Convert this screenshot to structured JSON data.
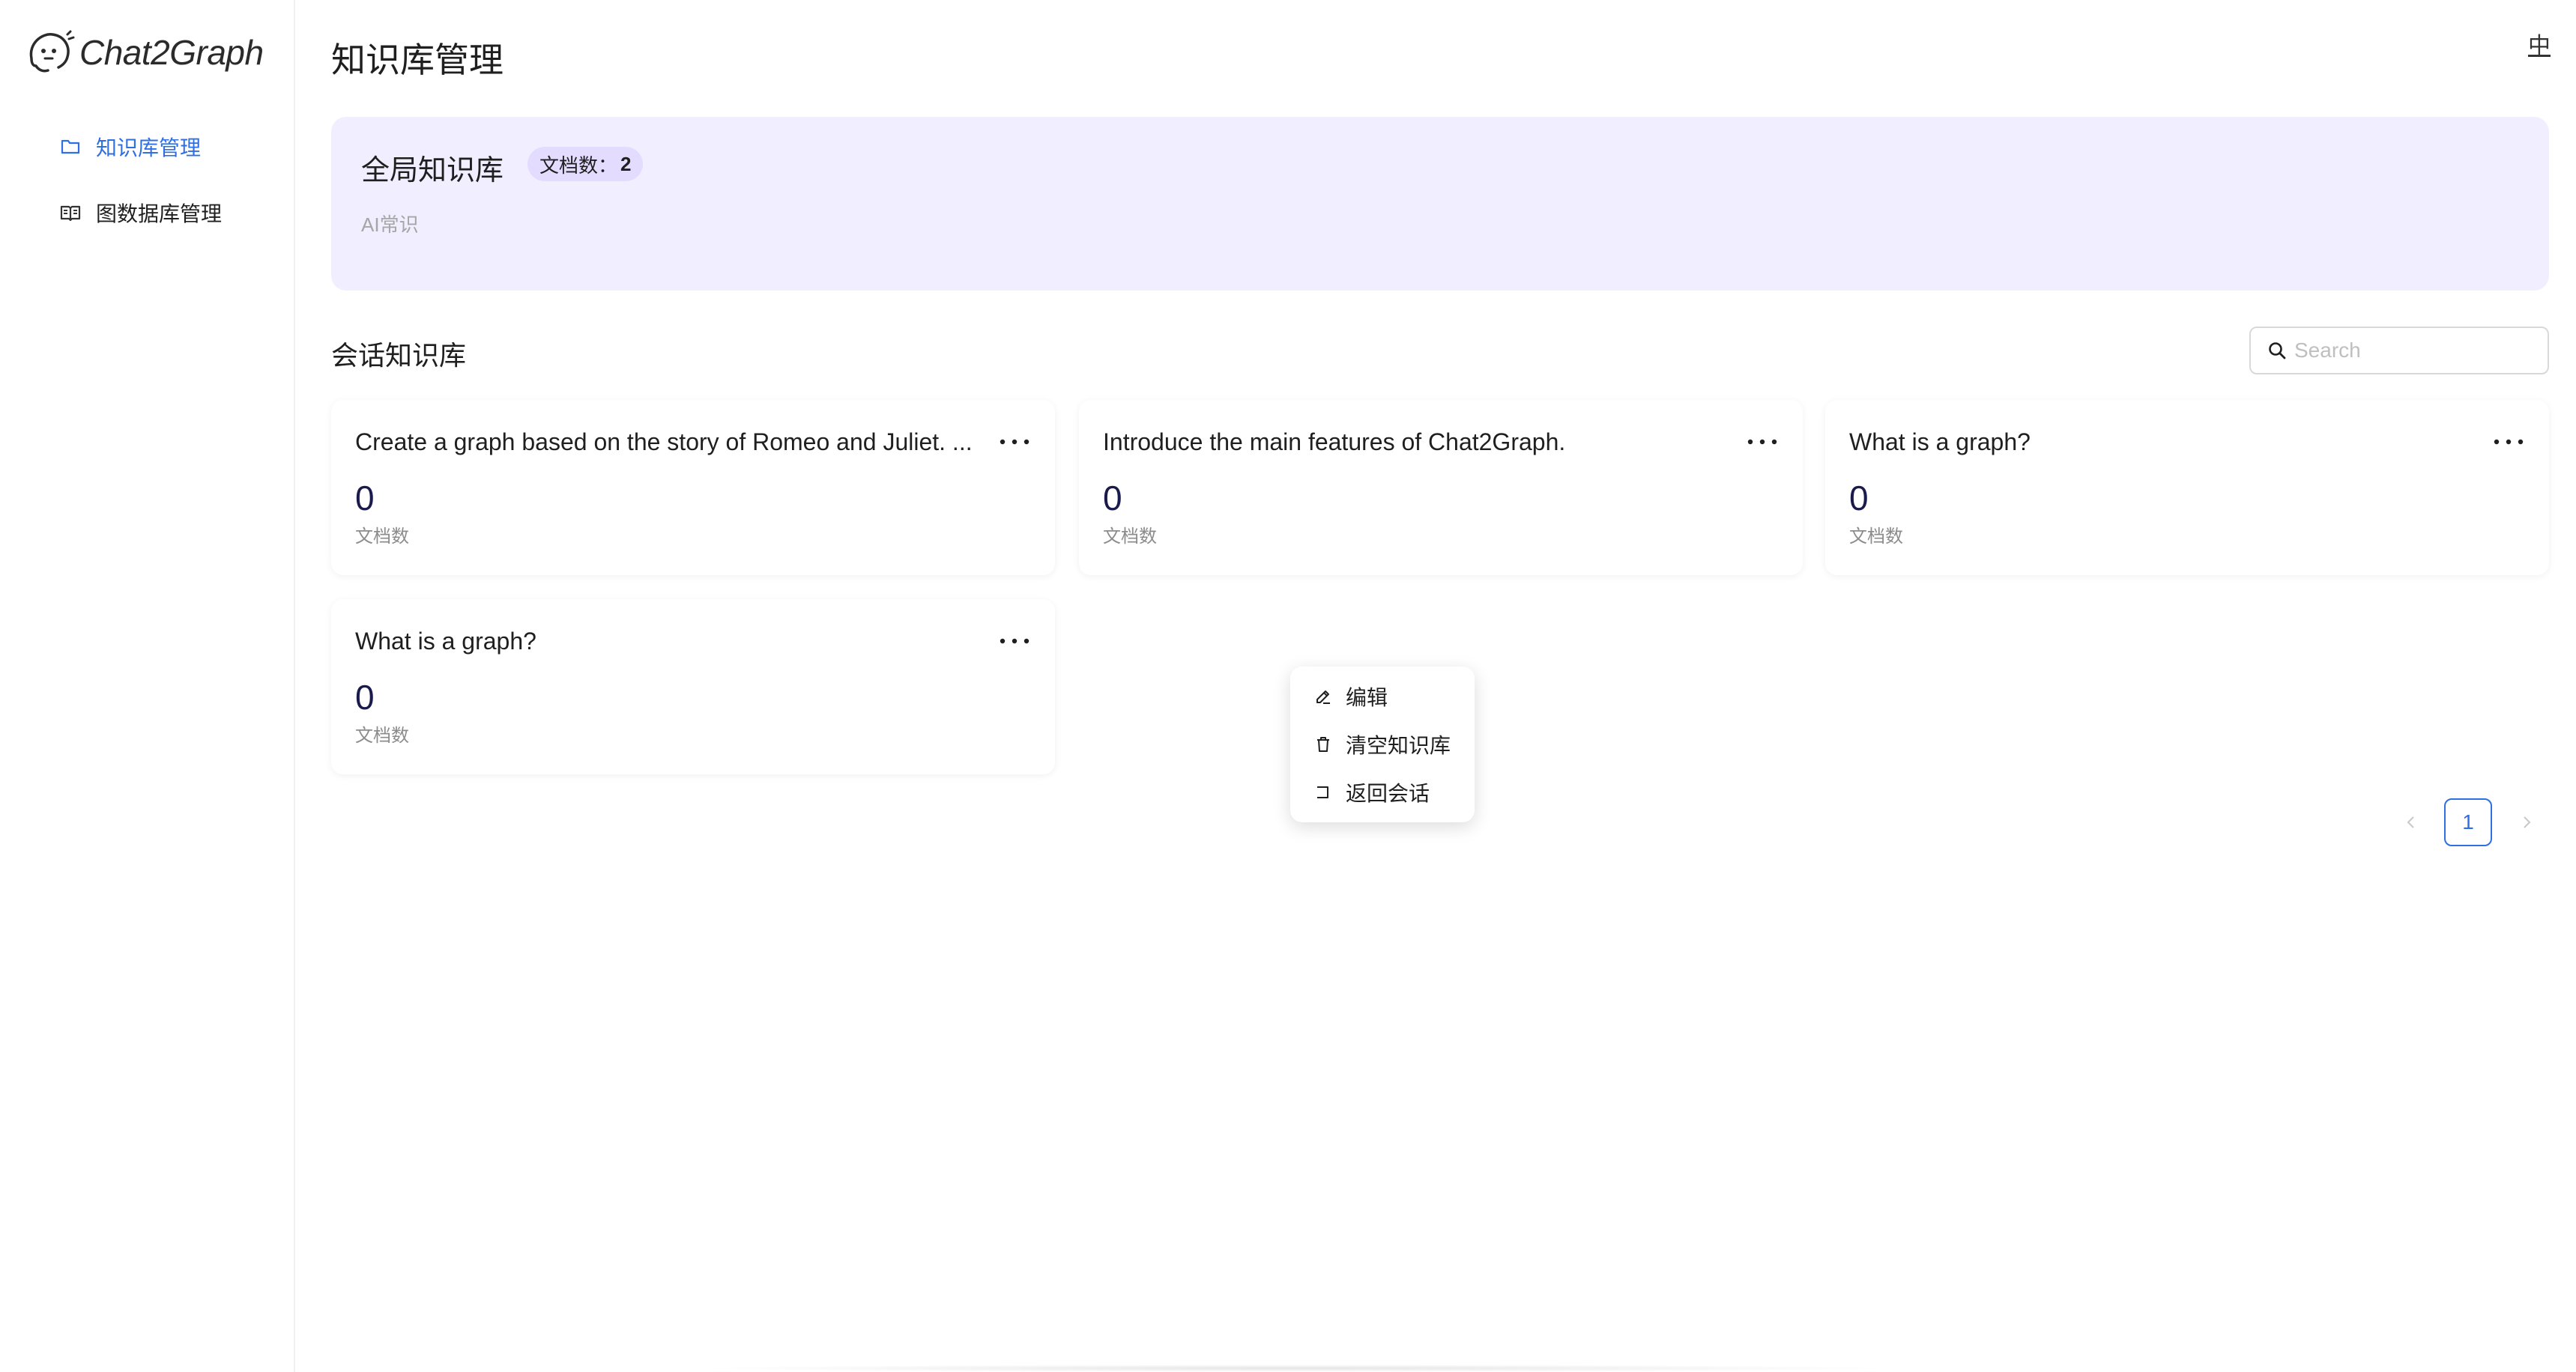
{
  "app": {
    "logo_text": "Chat2Graph"
  },
  "sidebar": {
    "items": [
      {
        "label": "知识库管理",
        "icon": "folder-icon",
        "active": true
      },
      {
        "label": "图数据库管理",
        "icon": "book-icon",
        "active": false
      }
    ]
  },
  "header": {
    "title": "知识库管理",
    "lang_toggle": "中"
  },
  "global_kb": {
    "title": "全局知识库",
    "badge_label": "文档数：",
    "badge_count": "2",
    "description": "AI常识"
  },
  "session_kb": {
    "section_title": "会话知识库",
    "search": {
      "placeholder": "Search",
      "value": ""
    },
    "cards": [
      {
        "title": "Create a graph based on the story of Romeo and Juliet. ...",
        "count": "0",
        "count_label": "文档数"
      },
      {
        "title": "Introduce the main features of Chat2Graph.",
        "count": "0",
        "count_label": "文档数"
      },
      {
        "title": "What is a graph?",
        "count": "0",
        "count_label": "文档数"
      },
      {
        "title": "What is a graph?",
        "count": "0",
        "count_label": "文档数"
      }
    ]
  },
  "dropdown": {
    "items": [
      {
        "label": "编辑",
        "icon": "edit-icon"
      },
      {
        "label": "清空知识库",
        "icon": "trash-icon"
      },
      {
        "label": "返回会话",
        "icon": "return-icon"
      }
    ]
  },
  "pagination": {
    "current_page": "1"
  },
  "colors": {
    "accent": "#2f6fe4",
    "global_card_bg": "#f1efff",
    "badge_bg": "#e3dcff",
    "count_color": "#1b1a4d"
  }
}
